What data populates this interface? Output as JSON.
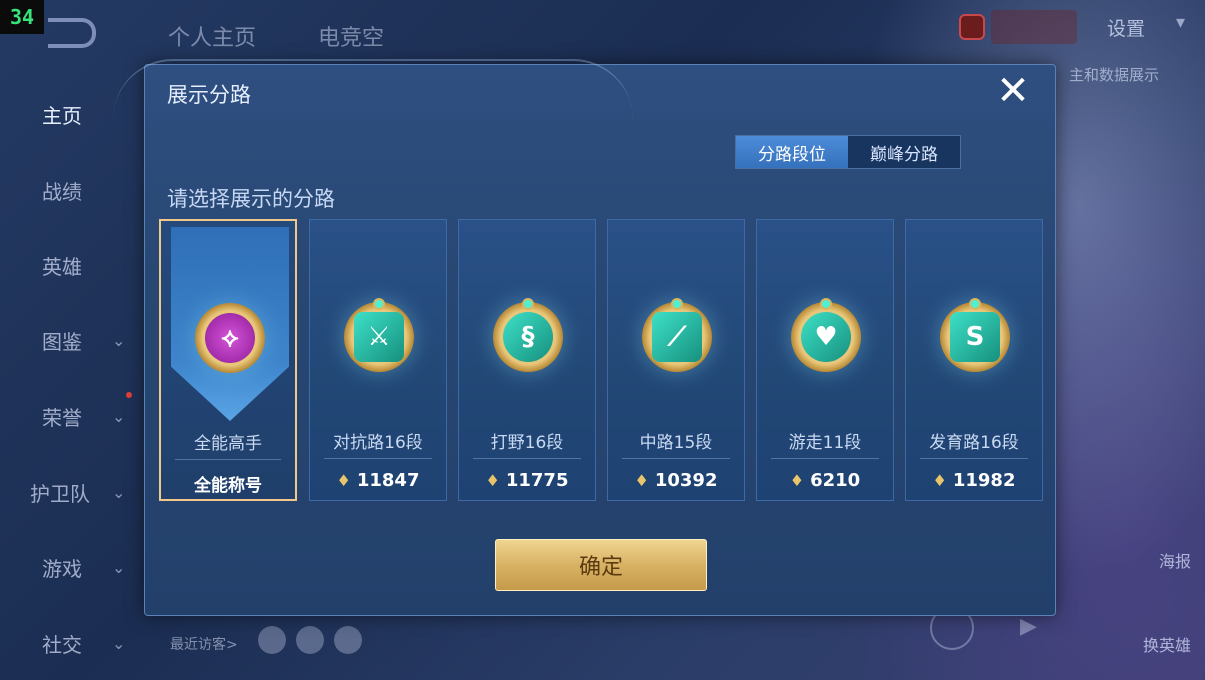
{
  "fps_counter": "34",
  "topbar": {
    "tabs": [
      "个人主页",
      "电竞空"
    ],
    "settings_label": "设置",
    "behind_text": "主和数据展示"
  },
  "sidebar": {
    "items": [
      {
        "label": "主页",
        "has_chevron": false
      },
      {
        "label": "战绩",
        "has_chevron": false
      },
      {
        "label": "英雄",
        "has_chevron": false
      },
      {
        "label": "图鉴",
        "has_chevron": true
      },
      {
        "label": "荣誉",
        "has_chevron": true
      },
      {
        "label": "护卫队",
        "has_chevron": true
      },
      {
        "label": "游戏",
        "has_chevron": true
      },
      {
        "label": "社交",
        "has_chevron": true
      }
    ]
  },
  "footer": {
    "recent_visitors": "最近访客>",
    "right_buttons": [
      "海报",
      "换英雄"
    ]
  },
  "modal": {
    "title": "展示分路",
    "close_icon": "✕",
    "segments": [
      {
        "label": "分路段位",
        "active": true
      },
      {
        "label": "巅峰分路",
        "active": false
      }
    ],
    "prompt": "请选择展示的分路",
    "cards": [
      {
        "label": "全能高手",
        "value": "全能称号",
        "icon": "allround-icon",
        "selected": true
      },
      {
        "label": "对抗路16段",
        "value": "11847",
        "icon": "clash-lane-icon",
        "selected": false
      },
      {
        "label": "打野16段",
        "value": "11775",
        "icon": "jungle-icon",
        "selected": false
      },
      {
        "label": "中路15段",
        "value": "10392",
        "icon": "mid-lane-icon",
        "selected": false
      },
      {
        "label": "游走11段",
        "value": "6210",
        "icon": "roam-icon",
        "selected": false
      },
      {
        "label": "发育路16段",
        "value": "11982",
        "icon": "farm-lane-icon",
        "selected": false
      }
    ],
    "confirm_label": "确定"
  },
  "colors": {
    "accent_gold": "#e8c56a",
    "selected_border": "#f1c889",
    "active_segment": "#3f7fcc"
  }
}
